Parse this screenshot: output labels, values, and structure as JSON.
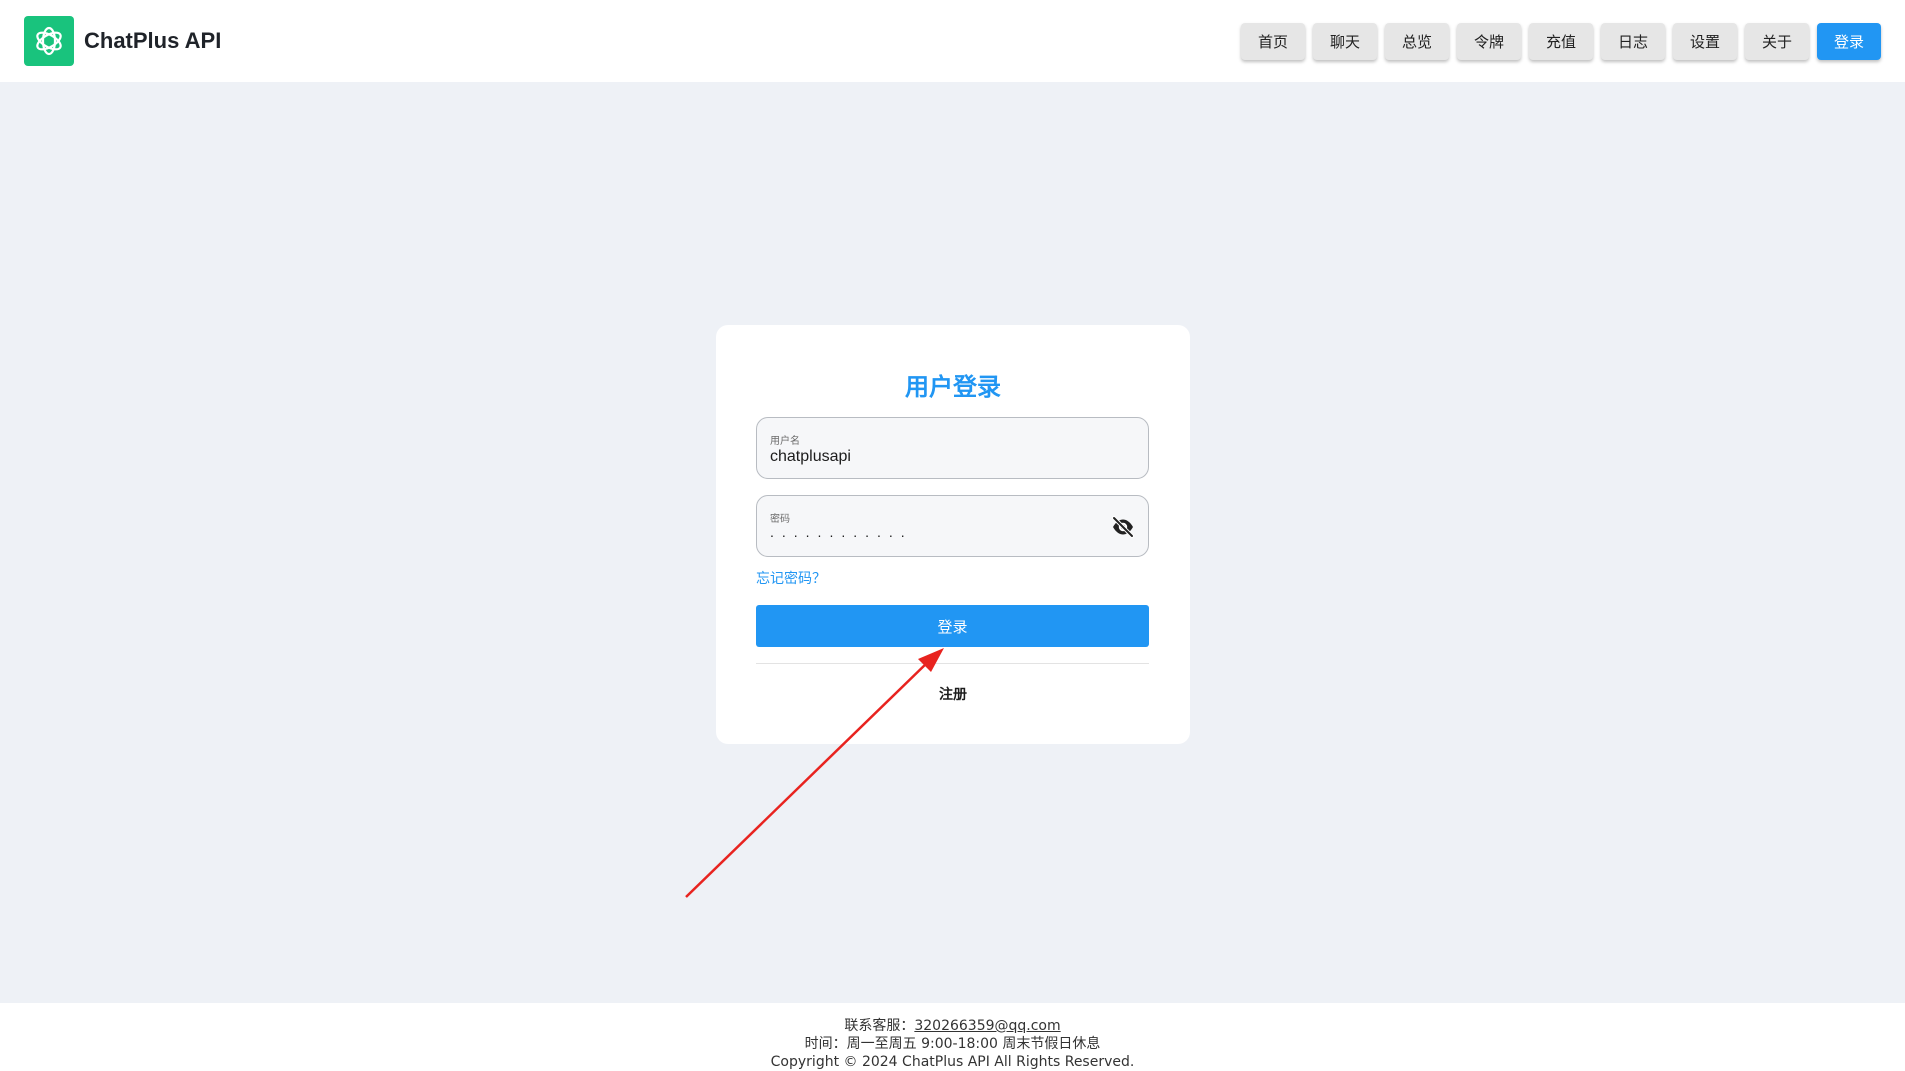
{
  "header": {
    "brand_name": "ChatPlus API",
    "nav": [
      {
        "label": "首页"
      },
      {
        "label": "聊天"
      },
      {
        "label": "总览"
      },
      {
        "label": "令牌"
      },
      {
        "label": "充值"
      },
      {
        "label": "日志"
      },
      {
        "label": "设置"
      },
      {
        "label": "关于"
      },
      {
        "label": "登录"
      }
    ]
  },
  "login": {
    "title": "用户登录",
    "username_label": "用户名",
    "username_value": "chatplusapi",
    "password_label": "密码",
    "password_value": "............",
    "forgot_label": "忘记密码？",
    "submit_label": "登录",
    "register_label": "注册"
  },
  "footer": {
    "contact_prefix": "联系客服：",
    "contact_email": "320266359@qq.com",
    "hours": "时间：周一至周五 9:00-18:00 周末节假日休息",
    "copyright": "Copyright © 2024 ChatPlus API All Rights Reserved."
  },
  "colors": {
    "accent": "#2196f3",
    "logo_bg": "#19c37d",
    "annotation_arrow": "#e8231f"
  },
  "icons": {
    "logo": "openai-logo-icon",
    "password_toggle": "eye-off-icon"
  }
}
